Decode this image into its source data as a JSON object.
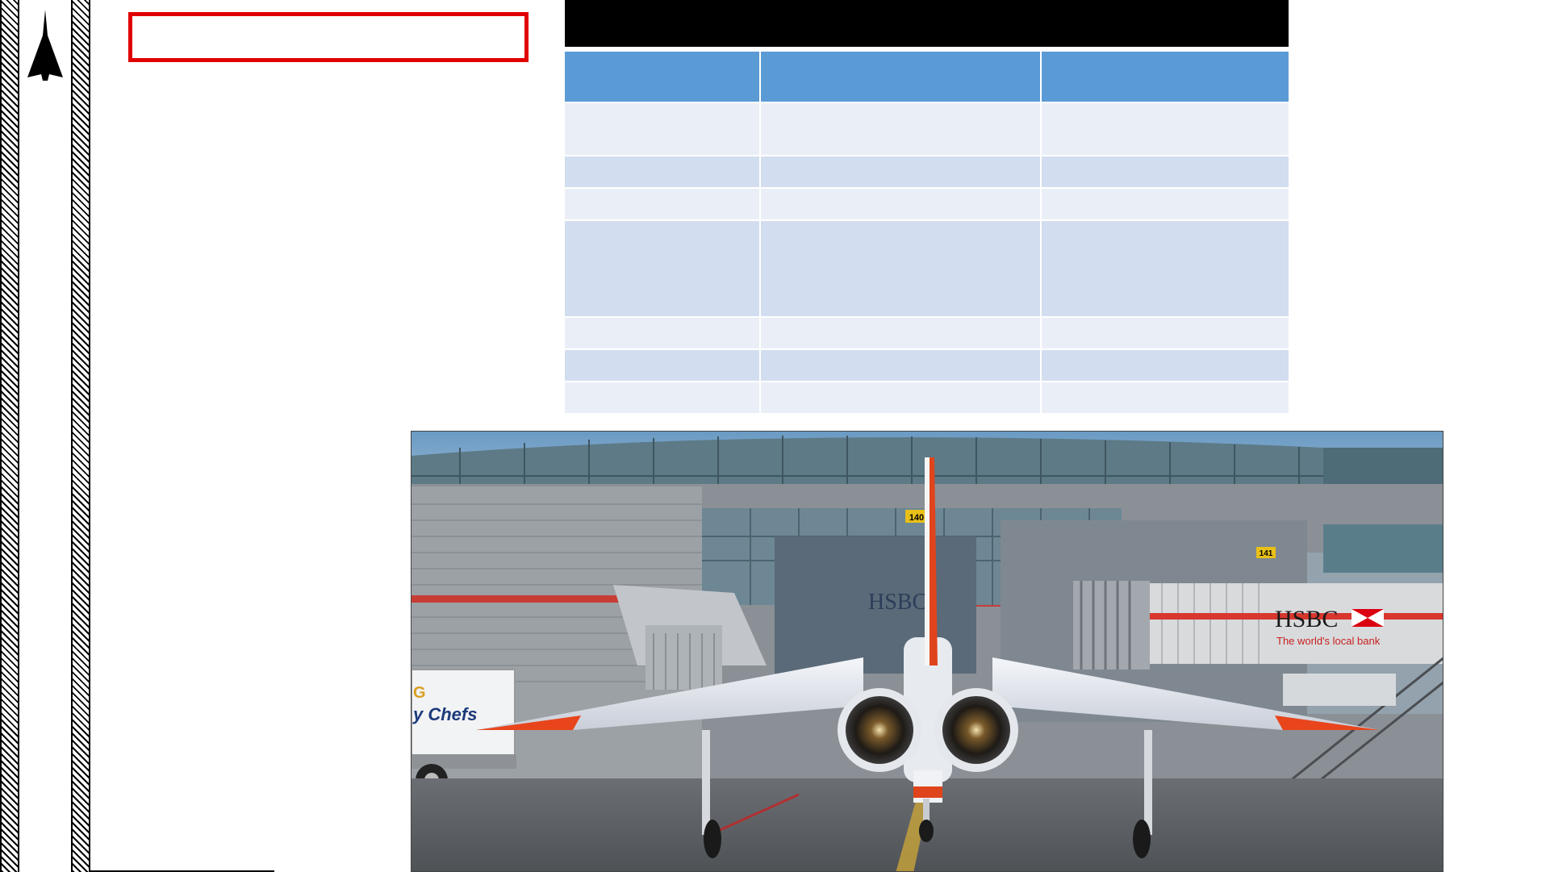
{
  "logo": {
    "icon": "jet-silhouette-icon"
  },
  "title_box": {
    "text": "",
    "border_color": "#e00000"
  },
  "table_header": {
    "title": ""
  },
  "table": {
    "columns": [
      "",
      "",
      ""
    ],
    "rows": [
      {
        "cells": [
          "",
          "",
          ""
        ],
        "shade": "light"
      },
      {
        "cells": [
          "",
          "",
          ""
        ],
        "shade": "dark"
      },
      {
        "cells": [
          "",
          "",
          ""
        ],
        "shade": "light"
      },
      {
        "cells": [
          "",
          "",
          ""
        ],
        "shade": "dark"
      },
      {
        "cells": [
          "",
          "",
          ""
        ],
        "shade": "light"
      },
      {
        "cells": [
          "",
          "",
          ""
        ],
        "shade": "dark"
      },
      {
        "cells": [
          "",
          "",
          ""
        ],
        "shade": "light"
      }
    ],
    "header_color": "#5b9bd5",
    "row_light_color": "#eaeff7",
    "row_dark_color": "#d2deef"
  },
  "photo": {
    "truck_text": "y Chefs",
    "truck_text_top": "G",
    "gate_140": "140",
    "gate_141": "141",
    "bank_name": "HSBC",
    "bank_tagline": "The world's local bank",
    "bank_name_left": "HSBC"
  }
}
